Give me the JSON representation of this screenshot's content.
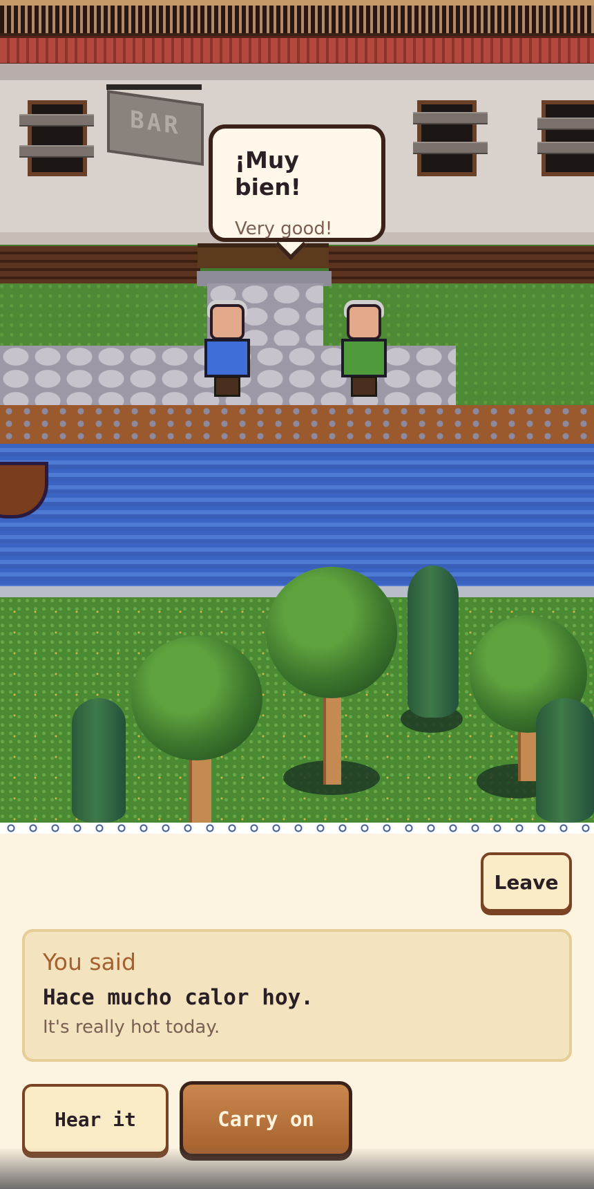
{
  "scene": {
    "sign_text": "BAR"
  },
  "speech_bubble": {
    "spanish": "¡Muy bien!",
    "english": "Very good!"
  },
  "controls": {
    "leave_label": "Leave",
    "hear_label": "Hear it",
    "carry_on_label": "Carry on"
  },
  "you_said": {
    "label": "You said",
    "spanish": "Hace mucho calor hoy.",
    "english": "It's really hot today."
  },
  "colors": {
    "panel_bg": "#fdf3e1",
    "card_bg": "#f4e3bf",
    "accent_brown": "#a4602f",
    "button_primary": "#b8733e",
    "dark_outline": "#3a2218"
  },
  "icons": [
    "speech-bubble-tail"
  ]
}
